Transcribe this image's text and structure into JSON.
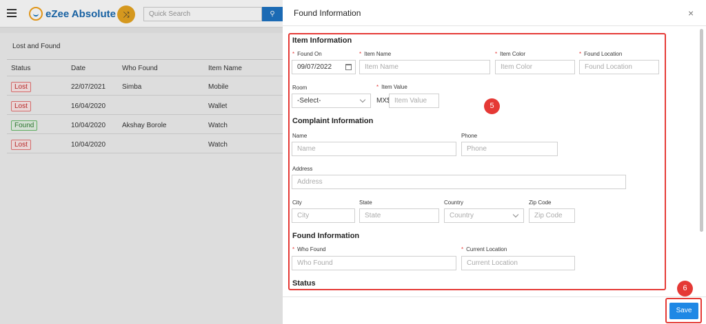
{
  "app": {
    "logo_text": "eZee Absolute",
    "search_placeholder": "Quick Search",
    "search_icon": "search-icon",
    "shuffle_icon": "shuffle-icon"
  },
  "panel": {
    "title": "Lost and Found",
    "columns": [
      "Status",
      "Date",
      "Who Found",
      "Item Name"
    ],
    "rows": [
      {
        "status": "Lost",
        "date": "22/07/2021",
        "who": "Simba",
        "item": "Mobile"
      },
      {
        "status": "Lost",
        "date": "16/04/2020",
        "who": "",
        "item": "Wallet"
      },
      {
        "status": "Found",
        "date": "10/04/2020",
        "who": "Akshay Borole",
        "item": "Watch"
      },
      {
        "status": "Lost",
        "date": "10/04/2020",
        "who": "",
        "item": "Watch"
      }
    ]
  },
  "drawer": {
    "title": "Found Information",
    "close": "×",
    "sections": {
      "item": "Item Information",
      "complaint": "Complaint Information",
      "found": "Found Information",
      "status": "Status"
    },
    "fields": {
      "found_on": {
        "label": "Found On",
        "value": "09/07/2022"
      },
      "item_name": {
        "label": "Item Name",
        "placeholder": "Item Name"
      },
      "item_color": {
        "label": "Item Color",
        "placeholder": "Item Color"
      },
      "found_location": {
        "label": "Found Location",
        "placeholder": "Found Location"
      },
      "room": {
        "label": "Room",
        "value": "-Select-"
      },
      "item_value": {
        "label": "Item Value",
        "prefix": "MX$",
        "placeholder": "Item Value"
      },
      "name": {
        "label": "Name",
        "placeholder": "Name"
      },
      "phone": {
        "label": "Phone",
        "placeholder": "Phone"
      },
      "address": {
        "label": "Address",
        "placeholder": "Address"
      },
      "city": {
        "label": "City",
        "placeholder": "City"
      },
      "state": {
        "label": "State",
        "placeholder": "State"
      },
      "country": {
        "label": "Country",
        "placeholder": "Country"
      },
      "zip": {
        "label": "Zip Code",
        "placeholder": "Zip Code"
      },
      "who_found": {
        "label": "Who Found",
        "placeholder": "Who Found"
      },
      "current_location": {
        "label": "Current Location",
        "placeholder": "Current Location"
      }
    },
    "markers": {
      "form": "5",
      "save": "6"
    },
    "save_label": "Save"
  },
  "colors": {
    "accent": "#1e88e5",
    "highlight": "#e53935",
    "brand": "#1a6ab0",
    "logo_orange": "#e8a521"
  }
}
